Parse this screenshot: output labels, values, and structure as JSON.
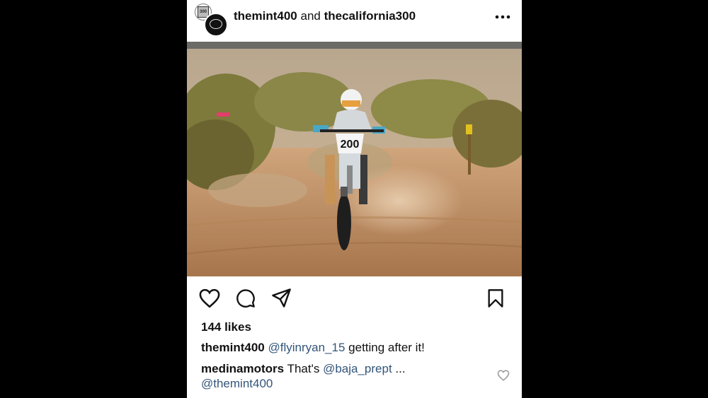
{
  "post": {
    "account_primary": "themint400",
    "conjunction": "and",
    "account_secondary": "thecalifornia300",
    "avatar_badge_text": "300",
    "photo_bib_number": "200",
    "likes": "144 likes",
    "caption": {
      "username": "themint400",
      "mention": "@flyinryan_15",
      "text": "getting after it!"
    },
    "comment": {
      "username": "medinamotors",
      "text": "That's",
      "mention1": "@baja_prept",
      "ellipsis": "...",
      "mention2": "@themint400"
    }
  },
  "icons": {
    "more": "more-options-icon",
    "like": "heart-icon",
    "comment": "comment-icon",
    "share": "send-icon",
    "save": "bookmark-icon",
    "comment_like": "heart-icon"
  },
  "colors": {
    "mention": "#33557a",
    "background": "#000000",
    "card": "#ffffff"
  }
}
